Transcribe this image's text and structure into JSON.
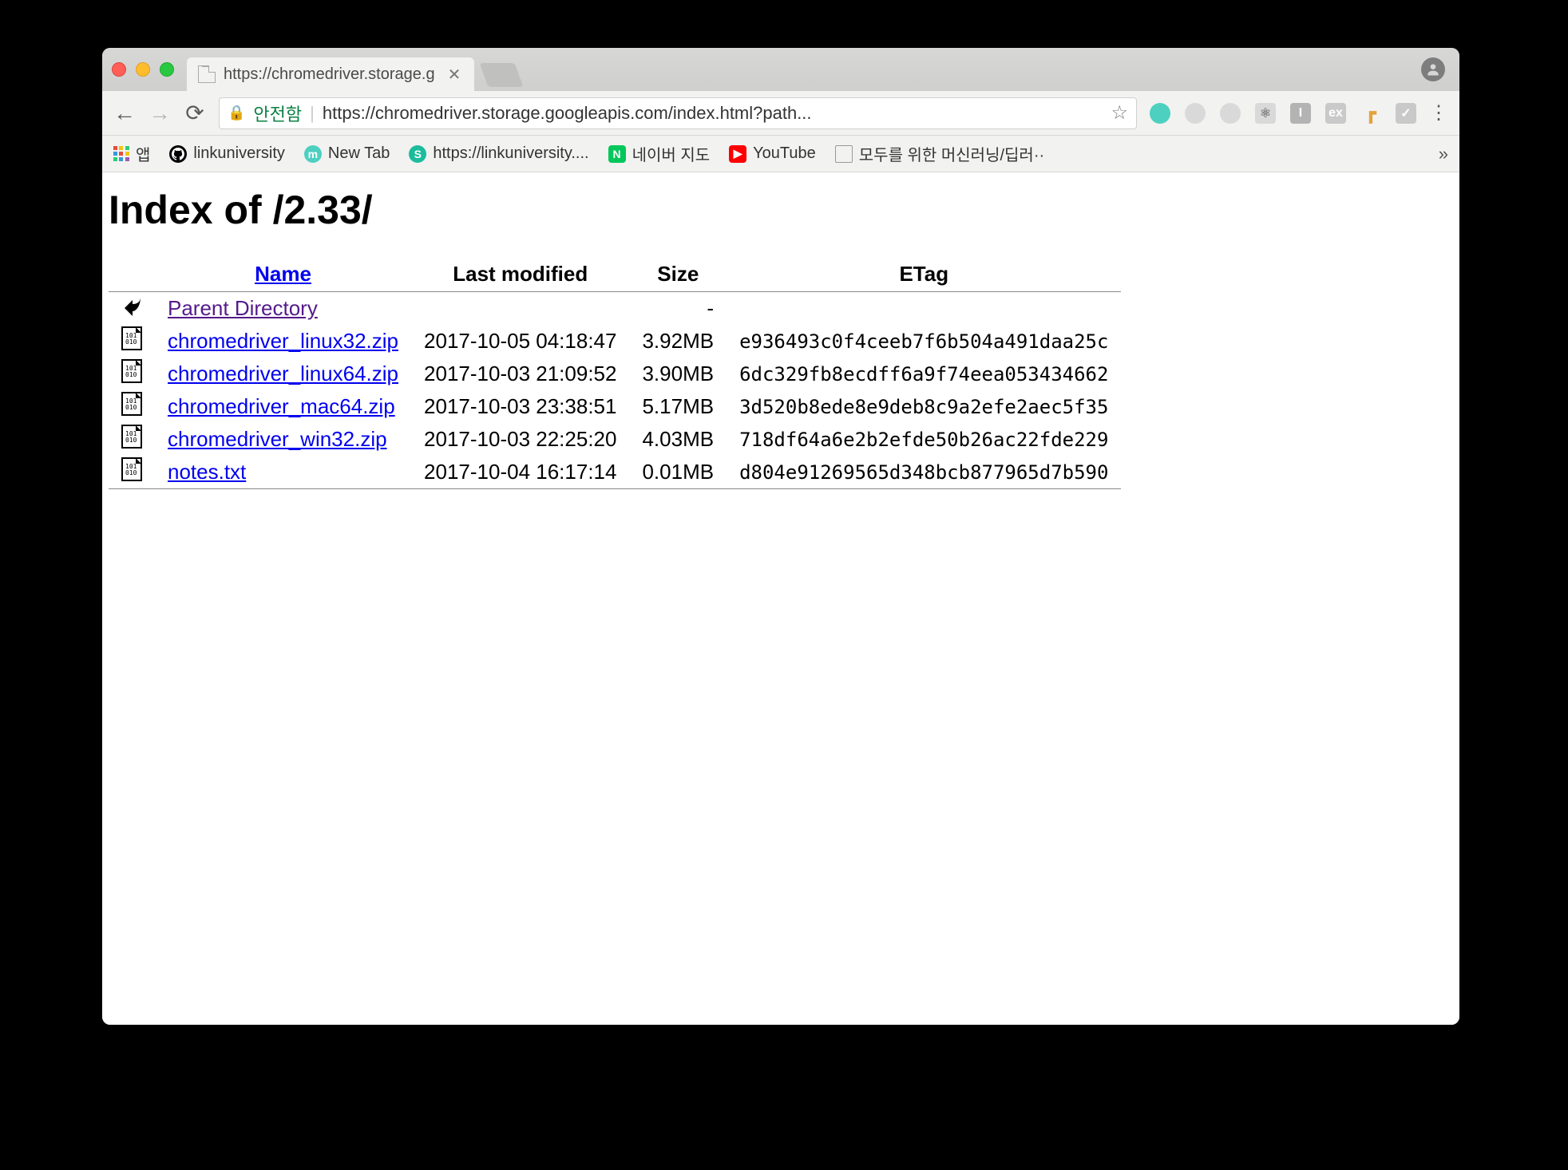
{
  "tab": {
    "title": "https://chromedriver.storage.g"
  },
  "nav": {
    "secure_label": "안전함",
    "url": "https://chromedriver.storage.googleapis.com/index.html?path..."
  },
  "bookmarks": {
    "apps_label": "앱",
    "items": [
      {
        "label": "linkuniversity"
      },
      {
        "label": "New Tab"
      },
      {
        "label": "https://linkuniversity...."
      },
      {
        "label": "네이버 지도"
      },
      {
        "label": "YouTube"
      },
      {
        "label": "모두를 위한 머신러닝/딥러··"
      }
    ]
  },
  "page": {
    "title": "Index of /2.33/",
    "headers": {
      "name": "Name",
      "last_modified": "Last modified",
      "size": "Size",
      "etag": "ETag"
    },
    "parent": {
      "label": "Parent Directory",
      "size": "-"
    },
    "files": [
      {
        "name": "chromedriver_linux32.zip",
        "modified": "2017-10-05 04:18:47",
        "size": "3.92MB",
        "etag": "e936493c0f4ceeb7f6b504a491daa25c"
      },
      {
        "name": "chromedriver_linux64.zip",
        "modified": "2017-10-03 21:09:52",
        "size": "3.90MB",
        "etag": "6dc329fb8ecdff6a9f74eea053434662"
      },
      {
        "name": "chromedriver_mac64.zip",
        "modified": "2017-10-03 23:38:51",
        "size": "5.17MB",
        "etag": "3d520b8ede8e9deb8c9a2efe2aec5f35"
      },
      {
        "name": "chromedriver_win32.zip",
        "modified": "2017-10-03 22:25:20",
        "size": "4.03MB",
        "etag": "718df64a6e2b2efde50b26ac22fde229"
      },
      {
        "name": "notes.txt",
        "modified": "2017-10-04 16:17:14",
        "size": "0.01MB",
        "etag": "d804e91269565d348bcb877965d7b590"
      }
    ]
  }
}
